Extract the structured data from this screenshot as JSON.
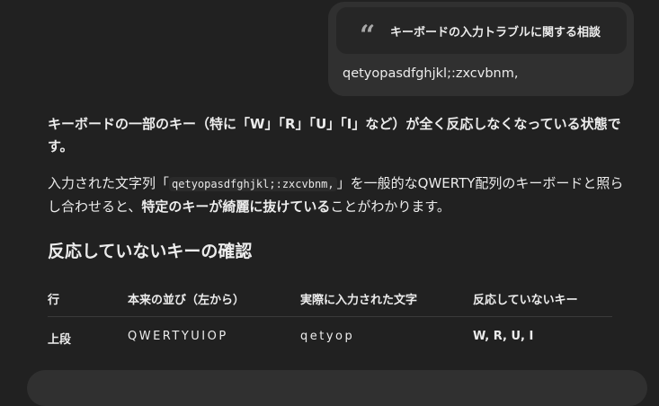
{
  "user_message": {
    "quote_title": "キーボードの入力トラブルに関する相談",
    "text": "qetyopasdfghjkl;:zxcvbnm,"
  },
  "answer": {
    "p1": "キーボードの一部のキー（特に「W」「R」「U」「I」など）が全く反応しなくなっている状態です。",
    "p2_pre": "入力された文字列「",
    "p2_code": "qetyopasdfghjkl;:zxcvbnm,",
    "p2_mid": "」を一般的なQWERTY配列のキーボードと照らし合わせると、",
    "p2_bold": "特定のキーが綺麗に抜けている",
    "p2_post": "ことがわかります。",
    "heading": "反応していないキーの確認"
  },
  "table": {
    "headers": [
      "行",
      "本来の並び（左から）",
      "実際に入力された文字",
      "反応していないキー"
    ],
    "rows": [
      [
        "上段",
        "QWERTYUIOP",
        "qetyop",
        "W, R, U, I"
      ]
    ]
  },
  "colors": {
    "background": "#212121",
    "bubble": "#303030",
    "text": "#ececec"
  },
  "icons": [
    "quote-icon"
  ]
}
